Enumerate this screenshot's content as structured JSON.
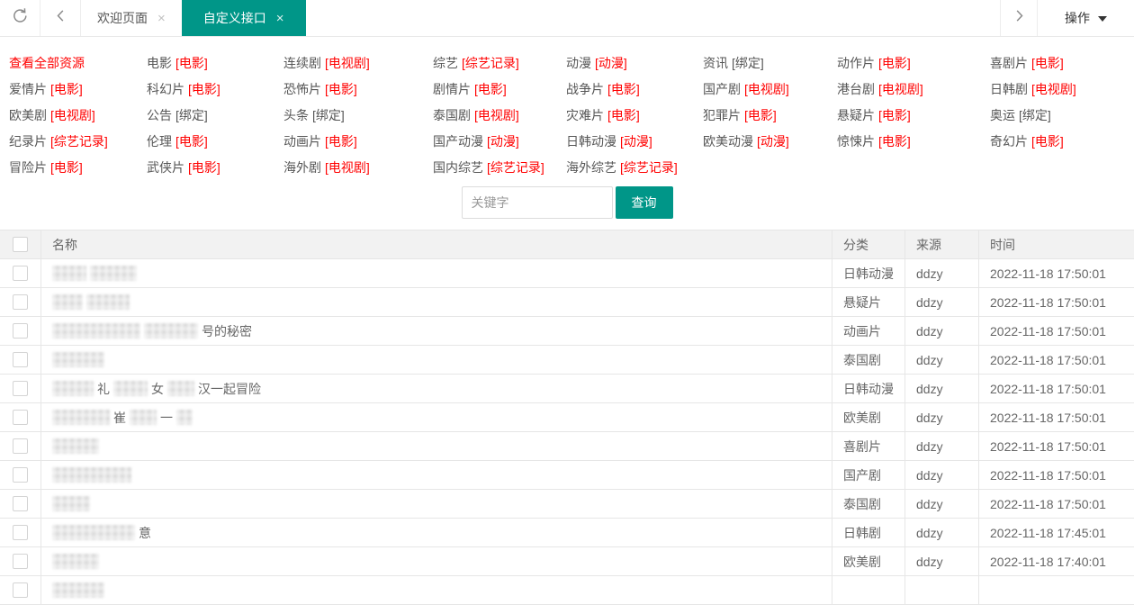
{
  "colors": {
    "accent": "#009688",
    "link_red": "#ff0000"
  },
  "topbar": {
    "refresh_icon": "refresh",
    "prev_icon": "chevron-left",
    "next_icon": "chevron-right",
    "close_icon": "×",
    "tabs": [
      {
        "label": "欢迎页面",
        "active": false
      },
      {
        "label": "自定义接口",
        "active": true
      }
    ],
    "actions_label": "操作"
  },
  "categories": {
    "items": [
      {
        "label": "查看全部资源",
        "tag": "",
        "red": true,
        "all": true
      },
      {
        "label": "电影",
        "tag": "[电影]",
        "red": true
      },
      {
        "label": "连续剧",
        "tag": "[电视剧]",
        "red": true
      },
      {
        "label": "综艺",
        "tag": "[综艺记录]",
        "red": true
      },
      {
        "label": "动漫",
        "tag": "[动漫]",
        "red": true
      },
      {
        "label": "资讯",
        "tag": "[绑定]",
        "red": false
      },
      {
        "label": "动作片",
        "tag": "[电影]",
        "red": true
      },
      {
        "label": "喜剧片",
        "tag": "[电影]",
        "red": true
      },
      {
        "label": "爱情片",
        "tag": "[电影]",
        "red": true
      },
      {
        "label": "科幻片",
        "tag": "[电影]",
        "red": true
      },
      {
        "label": "恐怖片",
        "tag": "[电影]",
        "red": true
      },
      {
        "label": "剧情片",
        "tag": "[电影]",
        "red": true
      },
      {
        "label": "战争片",
        "tag": "[电影]",
        "red": true
      },
      {
        "label": "国产剧",
        "tag": "[电视剧]",
        "red": true
      },
      {
        "label": "港台剧",
        "tag": "[电视剧]",
        "red": true
      },
      {
        "label": "日韩剧",
        "tag": "[电视剧]",
        "red": true
      },
      {
        "label": "欧美剧",
        "tag": "[电视剧]",
        "red": true
      },
      {
        "label": "公告",
        "tag": "[绑定]",
        "red": false
      },
      {
        "label": "头条",
        "tag": "[绑定]",
        "red": false
      },
      {
        "label": "泰国剧",
        "tag": "[电视剧]",
        "red": true
      },
      {
        "label": "灾难片",
        "tag": "[电影]",
        "red": true
      },
      {
        "label": "犯罪片",
        "tag": "[电影]",
        "red": true
      },
      {
        "label": "悬疑片",
        "tag": "[电影]",
        "red": true
      },
      {
        "label": "奥运",
        "tag": "[绑定]",
        "red": false
      },
      {
        "label": "纪录片",
        "tag": "[综艺记录]",
        "red": true
      },
      {
        "label": "伦理",
        "tag": "[电影]",
        "red": true
      },
      {
        "label": "动画片",
        "tag": "[电影]",
        "red": true
      },
      {
        "label": "国产动漫",
        "tag": "[动漫]",
        "red": true
      },
      {
        "label": "日韩动漫",
        "tag": "[动漫]",
        "red": true
      },
      {
        "label": "欧美动漫",
        "tag": "[动漫]",
        "red": true
      },
      {
        "label": "惊悚片",
        "tag": "[电影]",
        "red": true
      },
      {
        "label": "奇幻片",
        "tag": "[电影]",
        "red": true
      },
      {
        "label": "冒险片",
        "tag": "[电影]",
        "red": true
      },
      {
        "label": "武侠片",
        "tag": "[电影]",
        "red": true
      },
      {
        "label": "海外剧",
        "tag": "[电视剧]",
        "red": true
      },
      {
        "label": "国内综艺",
        "tag": "[综艺记录]",
        "red": true
      },
      {
        "label": "海外综艺",
        "tag": "[综艺记录]",
        "red": true
      }
    ]
  },
  "search": {
    "placeholder": "关键字",
    "button_label": "查询"
  },
  "table": {
    "headers": {
      "name": "名称",
      "category": "分类",
      "source": "来源",
      "time": "时间"
    },
    "rows": [
      {
        "name_parts": [
          {
            "b": 38
          },
          {
            "b": 52
          }
        ],
        "category": "日韩动漫",
        "source": "ddzy",
        "time": "2022-11-18 17:50:01"
      },
      {
        "name_parts": [
          {
            "b": 34
          },
          {
            "b": 48
          }
        ],
        "category": "悬疑片",
        "source": "ddzy",
        "time": "2022-11-18 17:50:01"
      },
      {
        "name_parts": [
          {
            "b": 98
          },
          {
            "b": 60
          },
          {
            "t": "号的秘密"
          }
        ],
        "category": "动画片",
        "source": "ddzy",
        "time": "2022-11-18 17:50:01"
      },
      {
        "name_parts": [
          {
            "b": 58
          }
        ],
        "category": "泰国剧",
        "source": "ddzy",
        "time": "2022-11-18 17:50:01"
      },
      {
        "name_parts": [
          {
            "b": 46
          },
          {
            "t": "礼"
          },
          {
            "b": 38
          },
          {
            "t": "女"
          },
          {
            "b": 30
          },
          {
            "t": "汉一起冒险"
          }
        ],
        "category": "日韩动漫",
        "source": "ddzy",
        "time": "2022-11-18 17:50:01"
      },
      {
        "name_parts": [
          {
            "b": 64
          },
          {
            "t": "崔"
          },
          {
            "b": 30
          },
          {
            "t": "一"
          },
          {
            "b": 18
          }
        ],
        "category": "欧美剧",
        "source": "ddzy",
        "time": "2022-11-18 17:50:01"
      },
      {
        "name_parts": [
          {
            "b": 52
          }
        ],
        "category": "喜剧片",
        "source": "ddzy",
        "time": "2022-11-18 17:50:01"
      },
      {
        "name_parts": [
          {
            "b": 88
          }
        ],
        "category": "国产剧",
        "source": "ddzy",
        "time": "2022-11-18 17:50:01"
      },
      {
        "name_parts": [
          {
            "b": 42
          }
        ],
        "category": "泰国剧",
        "source": "ddzy",
        "time": "2022-11-18 17:50:01"
      },
      {
        "name_parts": [
          {
            "b": 92
          },
          {
            "t": "意"
          }
        ],
        "category": "日韩剧",
        "source": "ddzy",
        "time": "2022-11-18 17:45:01"
      },
      {
        "name_parts": [
          {
            "b": 52
          }
        ],
        "category": "欧美剧",
        "source": "ddzy",
        "time": "2022-11-18 17:40:01"
      },
      {
        "name_parts": [
          {
            "b": 58
          }
        ],
        "category": "",
        "source": "",
        "time": ""
      }
    ]
  }
}
